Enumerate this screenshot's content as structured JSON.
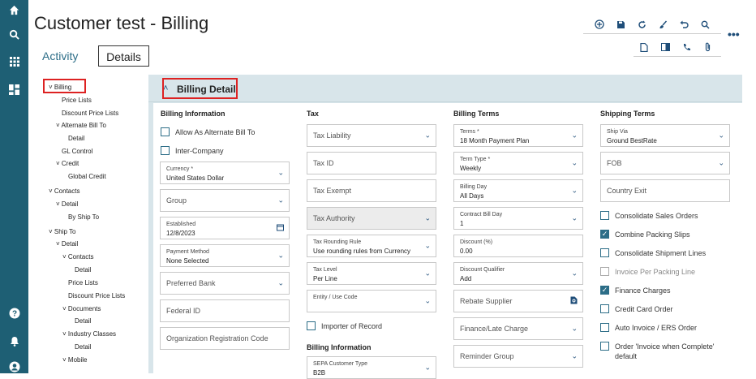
{
  "page_title": "Customer test - Billing",
  "tabs": {
    "activity": "Activity",
    "details": "Details"
  },
  "tree": [
    "Billing",
    "Price Lists",
    "Discount Price Lists",
    "Alternate Bill To",
    "Detail",
    "GL Control",
    "Credit",
    "Global Credit",
    "Contacts",
    "Detail",
    "By Ship To",
    "Ship To",
    "Detail",
    "Contacts",
    "Detail",
    "Price Lists",
    "Discount Price Lists",
    "Documents",
    "Detail",
    "Industry Classes",
    "Detail",
    "Mobile"
  ],
  "section_title": "Billing Detail",
  "columns": {
    "billing_info": "Billing Information",
    "tax": "Tax",
    "billing_terms": "Billing Terms",
    "shipping_terms": "Shipping Terms"
  },
  "billing_info": {
    "alt_bill_to": "Allow As Alternate Bill To",
    "inter_company": "Inter-Company",
    "currency_label": "Currency *",
    "currency_value": "United States Dollar",
    "group": "Group",
    "established_label": "Established",
    "established_value": "12/8/2023",
    "payment_label": "Payment Method",
    "payment_value": "None Selected",
    "preferred_bank": "Preferred Bank",
    "federal_id": "Federal ID",
    "org_reg": "Organization Registration Code"
  },
  "tax": {
    "liability": "Tax Liability",
    "tax_id": "Tax ID",
    "exempt": "Tax Exempt",
    "authority": "Tax Authority",
    "rounding_label": "Tax Rounding Rule",
    "rounding_value": "Use rounding rules from Currency",
    "level_label": "Tax Level",
    "level_value": "Per Line",
    "entity_label": "Entity / Use Code",
    "importer": "Importer of Record",
    "billing_info_head": "Billing Information",
    "sepa_label": "SEPA Customer Type",
    "sepa_value": "B2B"
  },
  "billing_terms": {
    "terms_label": "Terms *",
    "terms_value": "18 Month Payment Plan",
    "term_type_label": "Term Type *",
    "term_type_value": "Weekly",
    "billing_day_label": "Billing Day",
    "billing_day_value": "All Days",
    "contract_label": "Contract Bill Day",
    "contract_value": "1",
    "discount_label": "Discount (%)",
    "discount_value": "0.00",
    "qualifier_label": "Discount Qualifier",
    "qualifier_value": "Add",
    "rebate": "Rebate Supplier",
    "finance": "Finance/Late Charge",
    "reminder": "Reminder Group"
  },
  "shipping_terms": {
    "ship_via_label": "Ship Via",
    "ship_via_value": "Ground BestRate",
    "fob": "FOB",
    "country_exit": "Country Exit",
    "checks": [
      {
        "label": "Consolidate Sales Orders",
        "checked": false,
        "dim": false
      },
      {
        "label": "Combine Packing Slips",
        "checked": true,
        "dim": false
      },
      {
        "label": "Consolidate Shipment Lines",
        "checked": false,
        "dim": false
      },
      {
        "label": "Invoice Per Packing Line",
        "checked": false,
        "dim": true
      },
      {
        "label": "Finance Charges",
        "checked": true,
        "dim": false
      },
      {
        "label": "Credit Card Order",
        "checked": false,
        "dim": false
      },
      {
        "label": "Auto Invoice / ERS Order",
        "checked": false,
        "dim": false
      },
      {
        "label": "Order 'Invoice when Complete'",
        "label2": "default",
        "checked": false,
        "dim": false
      }
    ]
  },
  "colors": {
    "rail": "#1e5f74",
    "panel": "#d8e5ea",
    "accent": "#2c6d87",
    "highlight": "#dd2222"
  }
}
